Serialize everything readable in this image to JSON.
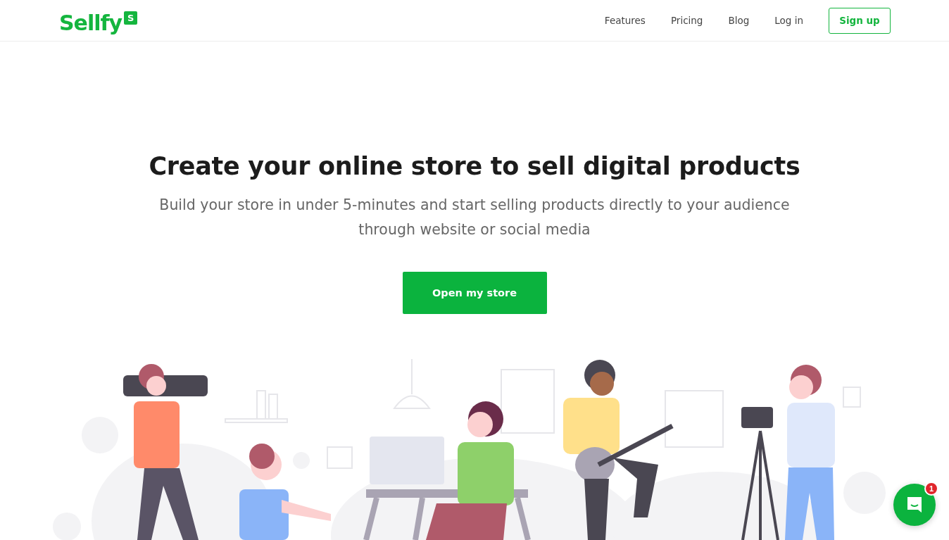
{
  "header": {
    "logo": {
      "name": "Sellfy",
      "badge": "S"
    },
    "nav": [
      {
        "label": "Features"
      },
      {
        "label": "Pricing"
      },
      {
        "label": "Blog"
      },
      {
        "label": "Log in"
      }
    ],
    "signup": "Sign up"
  },
  "hero": {
    "title": "Create your online store to sell digital products",
    "subtitle": "Build your store in under 5-minutes and start selling products directly to your audience through website or social media",
    "cta": "Open my store"
  },
  "chat": {
    "badge": "1"
  }
}
